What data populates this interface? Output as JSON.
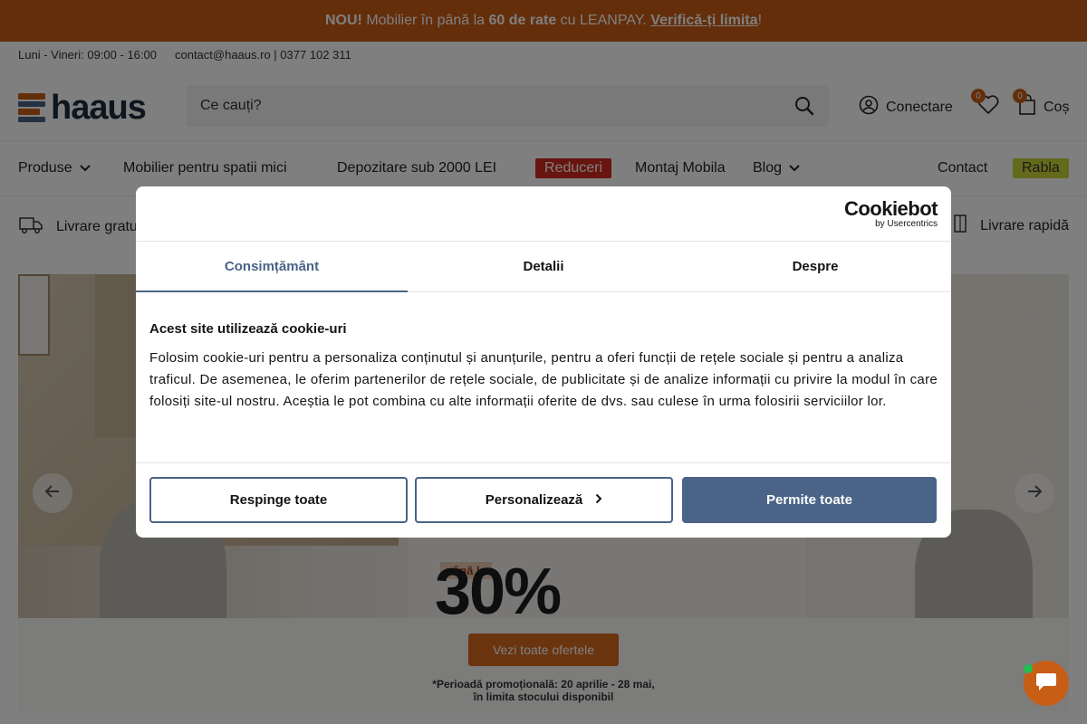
{
  "promo": {
    "new": "NOU!",
    "text1": " Mobilier în până la ",
    "rates": "60 de rate",
    "text2": " cu LEANPAY. ",
    "link": "Verifică-ți limita",
    "end": "!"
  },
  "info": {
    "hours": "Luni - Vineri: 09:00 - 16:00",
    "contact": "contact@haaus.ro | 0377 102 311"
  },
  "header": {
    "logo": "haaus",
    "search_placeholder": "Ce cauți?",
    "login": "Conectare",
    "wishlist_count": "0",
    "cart_count": "0",
    "cart": "Coș"
  },
  "nav": {
    "produse": "Produse",
    "spatii": "Mobilier pentru spatii mici",
    "depozitare": "Depozitare sub 2000 LEI",
    "reduceri": "Reduceri",
    "montaj": "Montaj Mobila",
    "blog": "Blog",
    "contact": "Contact",
    "rabla": "Rabla"
  },
  "usp": {
    "left": "Livrare gratu",
    "right": "Livrare rapidă"
  },
  "hero": {
    "pre": "până la",
    "headline": "30%",
    "cta": "Vezi toate ofertele",
    "note1": "*Perioadă promoțională: 20 aprilie - 28 mai,",
    "note2": "în limita stocului disponibil"
  },
  "cookie": {
    "brand": "Cookiebot",
    "brand_sub": "by Usercentrics",
    "tabs": [
      "Consimțământ",
      "Detalii",
      "Despre"
    ],
    "title": "Acest site utilizează cookie-uri",
    "text": "Folosim cookie-uri pentru a personaliza conținutul și anunțurile, pentru a oferi funcții de rețele sociale și pentru a analiza traficul. De asemenea, le oferim partenerilor de rețele sociale, de publicitate și de analize informații cu privire la modul în care folosiți site-ul nostru. Aceștia le pot combina cu alte informații oferite de dvs. sau culese în urma folosirii serviciilor lor.",
    "deny": "Respinge toate",
    "customize": "Personalizează",
    "allow": "Permite toate"
  },
  "colors": {
    "brand_orange": "#c85d16",
    "cookie_accent": "#4a6387",
    "sale_red": "#d12b1f",
    "rabla_green": "#c9d437"
  }
}
